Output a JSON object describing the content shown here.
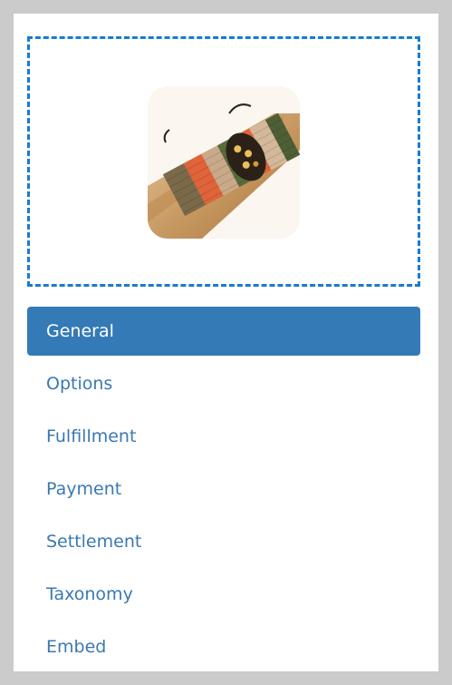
{
  "product": {
    "image_icon": "product-photo-knit-bracelet"
  },
  "nav": {
    "active_index": 0,
    "items": [
      {
        "label": "General"
      },
      {
        "label": "Options"
      },
      {
        "label": "Fulfillment"
      },
      {
        "label": "Payment"
      },
      {
        "label": "Settlement"
      },
      {
        "label": "Taxonomy"
      },
      {
        "label": "Embed"
      }
    ]
  },
  "colors": {
    "active_bg": "#337ab7",
    "link": "#3a78b3",
    "dropzone_border": "#1a7bd2",
    "page_bg": "#cbcbcb"
  }
}
